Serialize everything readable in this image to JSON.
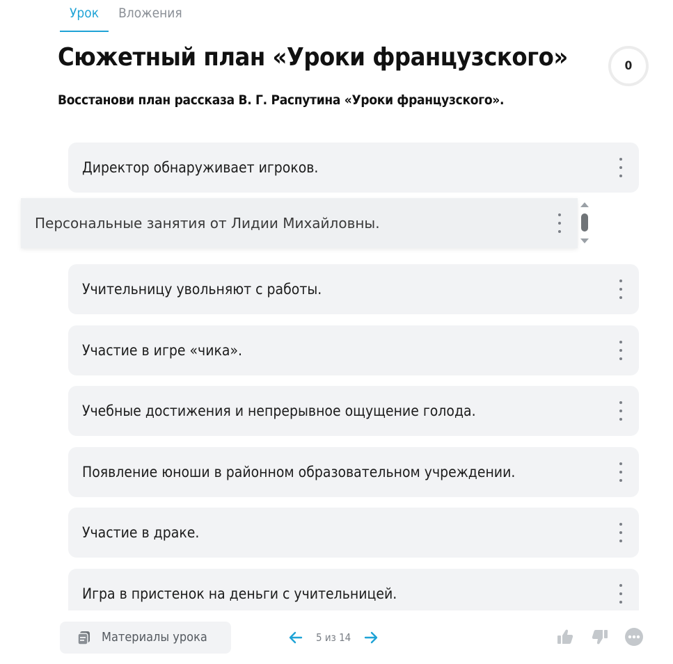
{
  "tabs": [
    {
      "label": "Урок"
    },
    {
      "label": "Вложения"
    }
  ],
  "lesson": {
    "title": "Сюжетный план «Уроки французского»",
    "instruction": "Восстанови план рассказа В. Г. Распутина «Уроки французского».",
    "score": "0"
  },
  "items": [
    {
      "text": "Директор обнаруживает игроков."
    },
    {
      "text": "Персональные занятия от Лидии Михайловны."
    },
    {
      "text": "Учительницу увольняют с работы."
    },
    {
      "text": "Участие в игре «чика»."
    },
    {
      "text": "Учебные достижения и непрерывное ощущение голода."
    },
    {
      "text": "Появление юноши в районном образовательном учреждении."
    },
    {
      "text": "Участие в драке."
    },
    {
      "text": "Игра в пристенок на деньги с учительницей."
    }
  ],
  "footer": {
    "materials_label": "Материалы урока",
    "pager": "5 из 14"
  },
  "colors": {
    "accent": "#1fa3d6",
    "card_bg": "#f2f3f5",
    "muted_icon": "#c4c8cc"
  },
  "icons": {
    "materials": "documents-icon",
    "prev": "arrow-left-icon",
    "next": "arrow-right-icon",
    "like": "thumbs-up-icon",
    "dislike": "thumbs-down-icon",
    "more": "more-horizontal-icon",
    "menu": "kebab-menu-icon"
  }
}
